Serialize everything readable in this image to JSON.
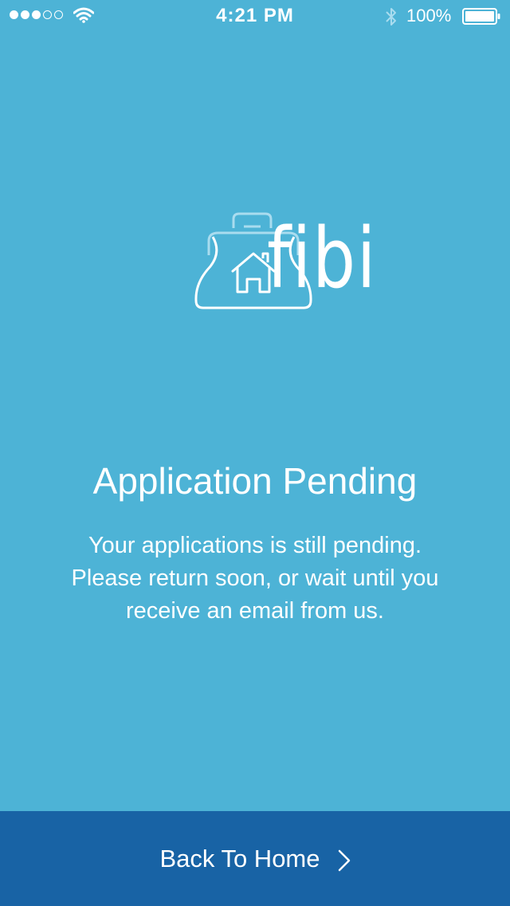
{
  "status_bar": {
    "time": "4:21 PM",
    "battery_percent": "100%",
    "signal_bars_filled": 3,
    "signal_bars_total": 5
  },
  "logo": {
    "brand": "fibi",
    "icon": "bag-with-house-icon"
  },
  "content": {
    "title": "Application Pending",
    "message_lines": [
      "Your applications is still pending.",
      "Please return soon, or wait until you",
      "receive an email from us."
    ]
  },
  "footer": {
    "button_label": "Back To Home",
    "button_icon": "chevron-right-icon"
  },
  "colors": {
    "background": "#4db3d6",
    "footer": "#1863a5",
    "text": "#ffffff"
  }
}
